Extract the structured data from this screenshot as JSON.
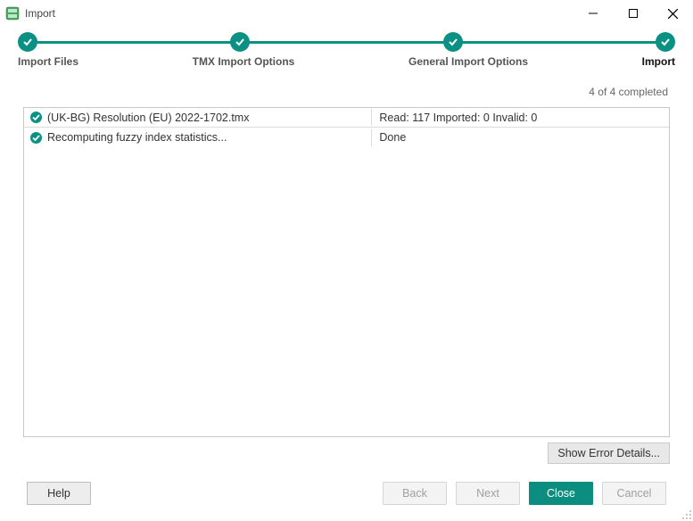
{
  "window": {
    "title": "Import"
  },
  "stepper": {
    "steps": [
      {
        "label": "Import Files"
      },
      {
        "label": "TMX Import Options"
      },
      {
        "label": "General Import Options"
      },
      {
        "label": "Import"
      }
    ],
    "activeIndex": 3
  },
  "progress": {
    "summary": "4 of 4 completed"
  },
  "tasks": [
    {
      "name": "(UK-BG) Resolution (EU) 2022-1702.tmx",
      "status": "Read: 117 Imported: 0 Invalid: 0"
    },
    {
      "name": "Recomputing fuzzy index statistics...",
      "status": "Done"
    }
  ],
  "buttons": {
    "showErrorDetails": "Show Error Details...",
    "help": "Help",
    "back": "Back",
    "next": "Next",
    "close": "Close",
    "cancel": "Cancel"
  },
  "colors": {
    "accent": "#0b9184",
    "primaryButton": "#0b8d80"
  }
}
